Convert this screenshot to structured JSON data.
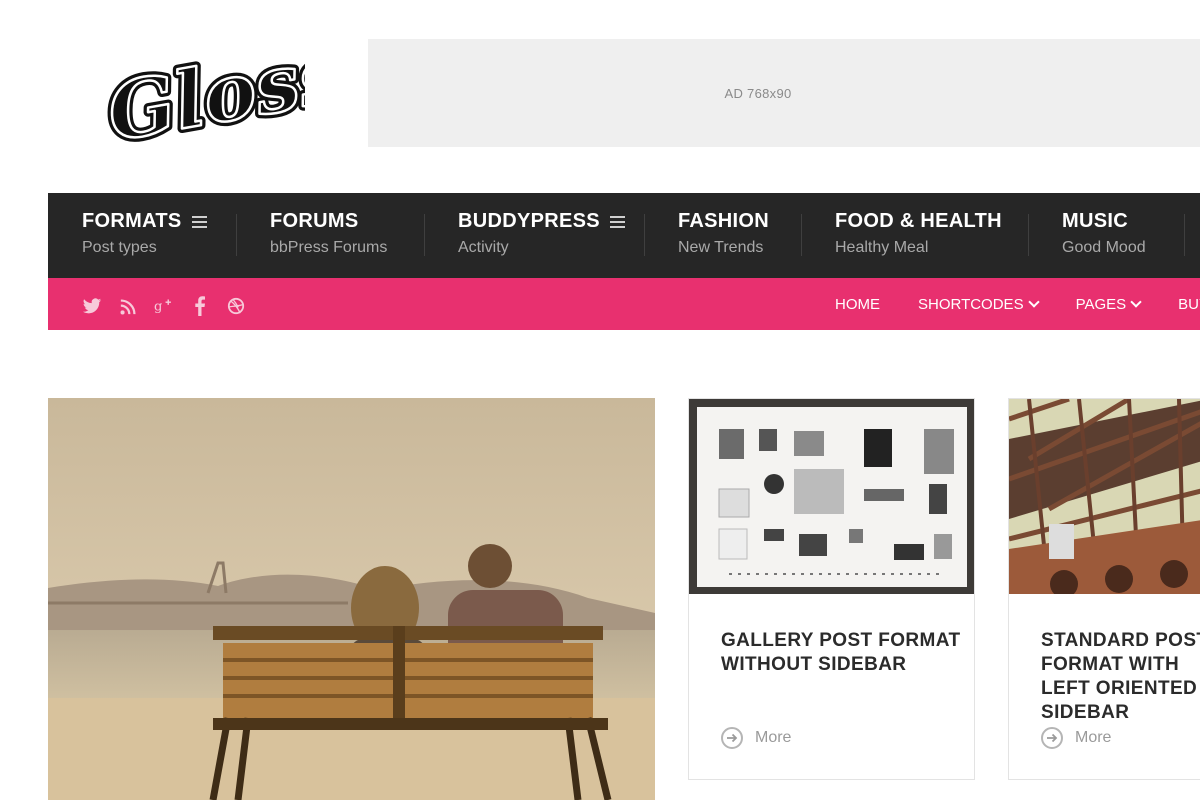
{
  "site": {
    "logo_text": "Gloss",
    "ad_label": "AD 768x90"
  },
  "main_nav": {
    "items": [
      {
        "title": "FORMATS",
        "subtitle": "Post types",
        "has_menu": true
      },
      {
        "title": "FORUMS",
        "subtitle": "bbPress Forums",
        "has_menu": false
      },
      {
        "title": "BUDDYPRESS",
        "subtitle": "Activity",
        "has_menu": true
      },
      {
        "title": "FASHION",
        "subtitle": "New Trends",
        "has_menu": false
      },
      {
        "title": "FOOD & HEALTH",
        "subtitle": "Healthy Meal",
        "has_menu": false
      },
      {
        "title": "MUSIC",
        "subtitle": "Good Mood",
        "has_menu": false
      }
    ]
  },
  "social_icons": [
    "twitter-icon",
    "rss-icon",
    "google-plus-icon",
    "facebook-icon",
    "dribbble-icon"
  ],
  "top_links": [
    {
      "label": "HOME",
      "dropdown": false
    },
    {
      "label": "SHORTCODES",
      "dropdown": true
    },
    {
      "label": "PAGES",
      "dropdown": true
    },
    {
      "label": "BUY",
      "dropdown": false
    }
  ],
  "cards": [
    {
      "title": "GALLERY POST FORMAT WITHOUT SIDEBAR",
      "more_label": "More"
    },
    {
      "title": "STANDARD POST FORMAT WITH LEFT ORIENTED SIDEBAR",
      "more_label": "More"
    }
  ],
  "colors": {
    "nav_bg": "#262626",
    "accent_pink": "#e8306f",
    "ad_bg": "#efefef"
  }
}
